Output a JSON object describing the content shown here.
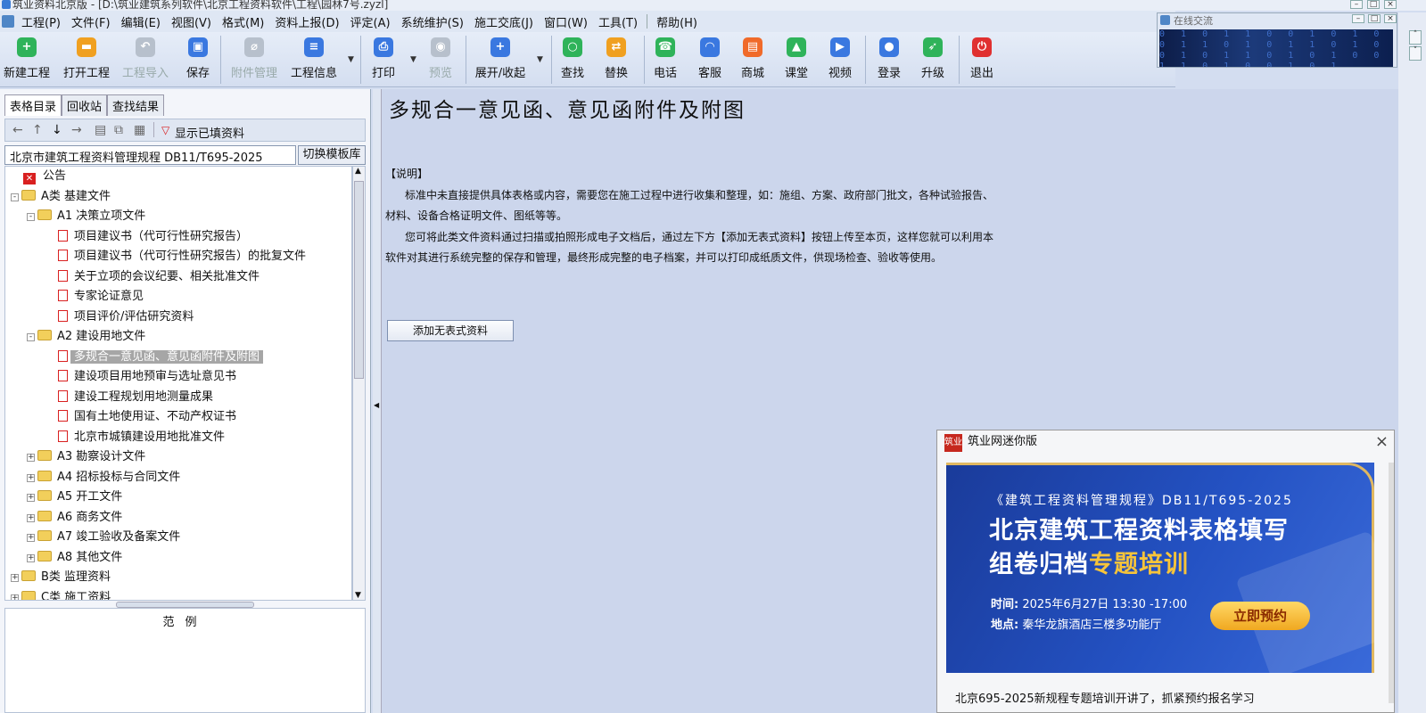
{
  "window": {
    "title": "筑业资料北京版 - [D:\\筑业建筑系列软件\\北京工程资料软件\\工程\\园林7号.zyzl]"
  },
  "menu": {
    "items": [
      "工程(P)",
      "文件(F)",
      "编辑(E)",
      "视图(V)",
      "格式(M)",
      "资料上报(D)",
      "评定(A)",
      "系统维护(S)",
      "施工交底(J)",
      "窗口(W)",
      "工具(T)"
    ],
    "help": "帮助(H)"
  },
  "toolbar": {
    "buttons": [
      {
        "label": "新建工程",
        "icon": "plus-icon",
        "color": "#2fb35a",
        "enabled": true
      },
      {
        "label": "打开工程",
        "icon": "folder-icon",
        "color": "#f0a020",
        "enabled": true
      },
      {
        "label": "工程导入",
        "icon": "undo-icon",
        "color": "#b7c0cc",
        "enabled": false
      },
      {
        "label": "保存",
        "icon": "save-icon",
        "color": "#3a78e0",
        "enabled": true
      },
      {
        "label": "附件管理",
        "icon": "paperclip-icon",
        "color": "#b7c0cc",
        "enabled": false
      },
      {
        "label": "工程信息",
        "icon": "list-icon",
        "color": "#3a78e0",
        "enabled": true
      },
      {
        "label": "打印",
        "icon": "printer-icon",
        "color": "#3a78e0",
        "enabled": true
      },
      {
        "label": "预览",
        "icon": "eye-icon",
        "color": "#b7c0cc",
        "enabled": false
      },
      {
        "label": "展开/收起",
        "icon": "plus-icon",
        "color": "#3a78e0",
        "enabled": true
      },
      {
        "label": "查找",
        "icon": "search-icon",
        "color": "#2fb35a",
        "enabled": true
      },
      {
        "label": "替换",
        "icon": "replace-icon",
        "color": "#f0a020",
        "enabled": true
      },
      {
        "label": "电话",
        "icon": "phone-icon",
        "color": "#2fb35a",
        "enabled": true
      },
      {
        "label": "客服",
        "icon": "headset-icon",
        "color": "#3a78e0",
        "enabled": true
      },
      {
        "label": "商城",
        "icon": "cart-icon",
        "color": "#f06a2a",
        "enabled": true
      },
      {
        "label": "课堂",
        "icon": "graduation-cap-icon",
        "color": "#2fb35a",
        "enabled": true
      },
      {
        "label": "视频",
        "icon": "play-icon",
        "color": "#3a78e0",
        "enabled": true
      },
      {
        "label": "登录",
        "icon": "user-icon",
        "color": "#3a78e0",
        "enabled": true
      },
      {
        "label": "升级",
        "icon": "rocket-icon",
        "color": "#2fb35a",
        "enabled": true
      },
      {
        "label": "退出",
        "icon": "power-icon",
        "color": "#e03030",
        "enabled": true
      }
    ]
  },
  "chat": {
    "title": "在线交流"
  },
  "left": {
    "tabs": [
      "表格目录",
      "回收站",
      "查找结果"
    ],
    "show_filled_label": "显示已填资料",
    "standard": "北京市建筑工程资料管理规程 DB11/T695-2025",
    "switch_label": "切换模板库",
    "tree": [
      {
        "label": "公告",
        "kind": "notice"
      },
      {
        "label": "A类 基建文件",
        "kind": "folder",
        "state": "-"
      },
      {
        "label": "A1 决策立项文件",
        "kind": "folder",
        "state": "-"
      },
      {
        "label": "项目建议书（代可行性研究报告）",
        "kind": "doc"
      },
      {
        "label": "项目建议书（代可行性研究报告）的批复文件",
        "kind": "doc"
      },
      {
        "label": "关于立项的会议纪要、相关批准文件",
        "kind": "doc"
      },
      {
        "label": "专家论证意见",
        "kind": "doc"
      },
      {
        "label": "项目评价/评估研究资料",
        "kind": "doc"
      },
      {
        "label": "A2 建设用地文件",
        "kind": "folder",
        "state": "-"
      },
      {
        "label": "多规合一意见函、意见函附件及附图",
        "kind": "doc",
        "selected": true
      },
      {
        "label": "建设项目用地预审与选址意见书",
        "kind": "doc"
      },
      {
        "label": "建设工程规划用地测量成果",
        "kind": "doc"
      },
      {
        "label": "国有土地使用证、不动产权证书",
        "kind": "doc"
      },
      {
        "label": "北京市城镇建设用地批准文件",
        "kind": "doc"
      },
      {
        "label": "A3 勘察设计文件",
        "kind": "folder",
        "state": "+"
      },
      {
        "label": "A4 招标投标与合同文件",
        "kind": "folder",
        "state": "+"
      },
      {
        "label": "A5 开工文件",
        "kind": "folder",
        "state": "+"
      },
      {
        "label": "A6 商务文件",
        "kind": "folder",
        "state": "+"
      },
      {
        "label": "A7 竣工验收及备案文件",
        "kind": "folder",
        "state": "+"
      },
      {
        "label": "A8 其他文件",
        "kind": "folder",
        "state": "+"
      },
      {
        "label": "B类 监理资料",
        "kind": "folder",
        "state": "+"
      },
      {
        "label": "C类 施工资料",
        "kind": "folder",
        "state": "+"
      }
    ],
    "legend_title": "范例"
  },
  "main": {
    "title": "多规合一意见函、意见函附件及附图",
    "note_heading": "【说明】",
    "note_lines": [
      "标准中未直接提供具体表格或内容，需要您在施工过程中进行收集和整理，如：施组、方案、政府部门批文，各种试验报告、",
      "材料、设备合格证明文件、图纸等等。",
      "您可将此类文件资料通过扫描或拍照形成电子文档后，通过左下方【添加无表式资料】按钮上传至本页，这样您就可以利用本",
      "软件对其进行系统完整的保存和管理，最终形成完整的电子档案，并可以打印成纸质文件，供现场检查、验收等使用。"
    ],
    "add_button": "添加无表式资料"
  },
  "mini": {
    "title": "筑业网迷你版",
    "logo_text": "筑业",
    "banner": {
      "line1": "《建筑工程资料管理规程》DB11/T695-2025",
      "line2": "北京建筑工程资料表格填写",
      "line3a": "组卷归档",
      "line3b": "专题培训",
      "time_label": "时间:",
      "time": "2025年6月27日  13:30 -17:00",
      "place_label": "地点:",
      "place": "秦华龙旗酒店三楼多功能厅",
      "button": "立即预约"
    },
    "caption": "北京695-2025新规程专题培训开讲了，抓紧预约报名学习"
  }
}
